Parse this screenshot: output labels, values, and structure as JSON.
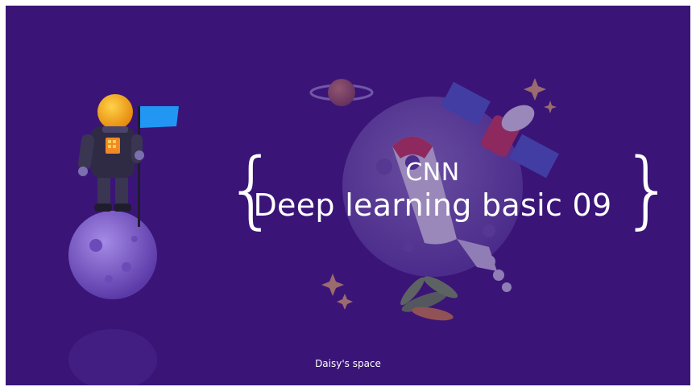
{
  "slide": {
    "title_line1": "CNN",
    "title_line2": "Deep learning basic 09",
    "footer": "Daisy's space"
  },
  "colors": {
    "background": "#3a1577",
    "text": "#ffffff",
    "helmet": "#f5a623",
    "flag": "#2196f3",
    "planet": "#7b5cc4"
  },
  "decor": {
    "left_illustration": "astronaut-on-planet-icon",
    "right_illustration": "planet-with-rocket-and-satellite-icon"
  }
}
